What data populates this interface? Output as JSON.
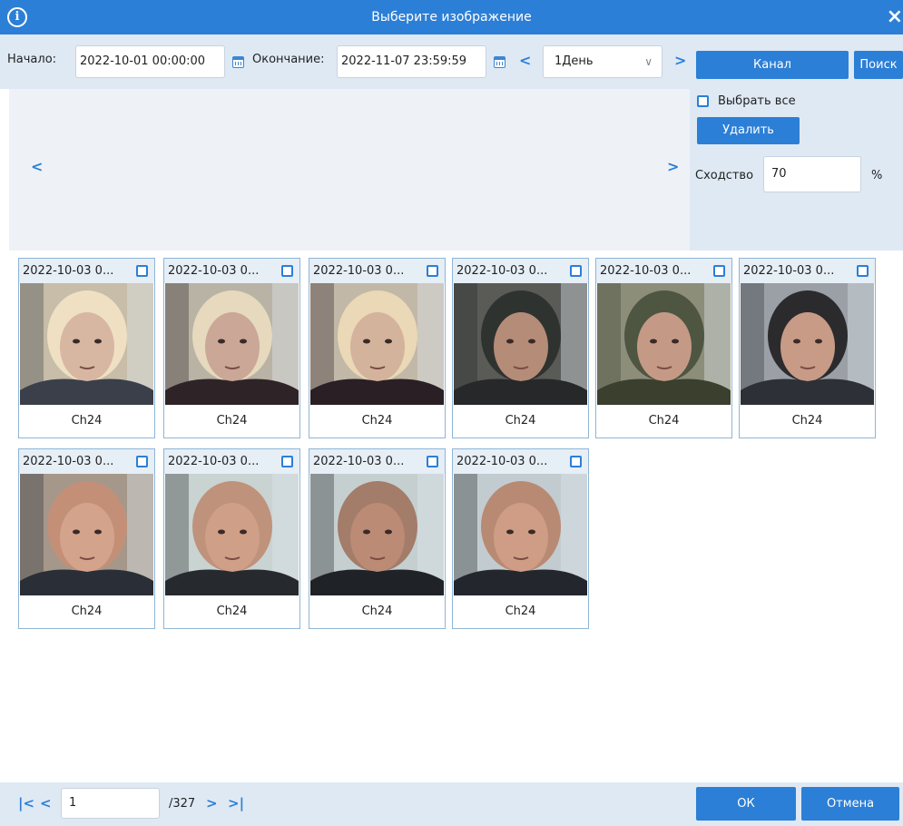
{
  "dialog": {
    "title": "Выберите изображение",
    "close_icon": "×"
  },
  "toolbar": {
    "start_label": "Начало:",
    "start_value": "2022-10-01 00:00:00",
    "end_label": "Окончание:",
    "end_value": "2022-11-07 23:59:59",
    "period_value": "1День",
    "channel_button": "Канал",
    "search_button": "Поиск"
  },
  "panel": {
    "select_all_label": "Выбрать все",
    "delete_button": "Удалить",
    "similarity_label": "Сходство",
    "similarity_value": "70",
    "percent_sign": "%"
  },
  "results": [
    {
      "timestamp": "2022-10-03 0...",
      "channel": "Ch24",
      "photo": "face-blonde-woman-1"
    },
    {
      "timestamp": "2022-10-03 0...",
      "channel": "Ch24",
      "photo": "face-blonde-woman-2"
    },
    {
      "timestamp": "2022-10-03 0...",
      "channel": "Ch24",
      "photo": "face-blonde-woman-3"
    },
    {
      "timestamp": "2022-10-03 0...",
      "channel": "Ch24",
      "photo": "face-man-dark-hood"
    },
    {
      "timestamp": "2022-10-03 0...",
      "channel": "Ch24",
      "photo": "face-man-camo-hood"
    },
    {
      "timestamp": "2022-10-03 0...",
      "channel": "Ch24",
      "photo": "face-man-dark-hair"
    },
    {
      "timestamp": "2022-10-03 0...",
      "channel": "Ch24",
      "photo": "face-bald-man-1"
    },
    {
      "timestamp": "2022-10-03 0...",
      "channel": "Ch24",
      "photo": "face-bald-man-2"
    },
    {
      "timestamp": "2022-10-03 0...",
      "channel": "Ch24",
      "photo": "face-bald-man-profile"
    },
    {
      "timestamp": "2022-10-03 0...",
      "channel": "Ch24",
      "photo": "face-bald-man-front"
    }
  ],
  "footer": {
    "current_page": "1",
    "total_pages": "/327",
    "ok_button": "ОК",
    "cancel_button": "Отмена"
  },
  "colors": {
    "accent": "#2c7fd6",
    "panel_bg": "#dfe9f4",
    "card_border": "#8fb5d6"
  }
}
